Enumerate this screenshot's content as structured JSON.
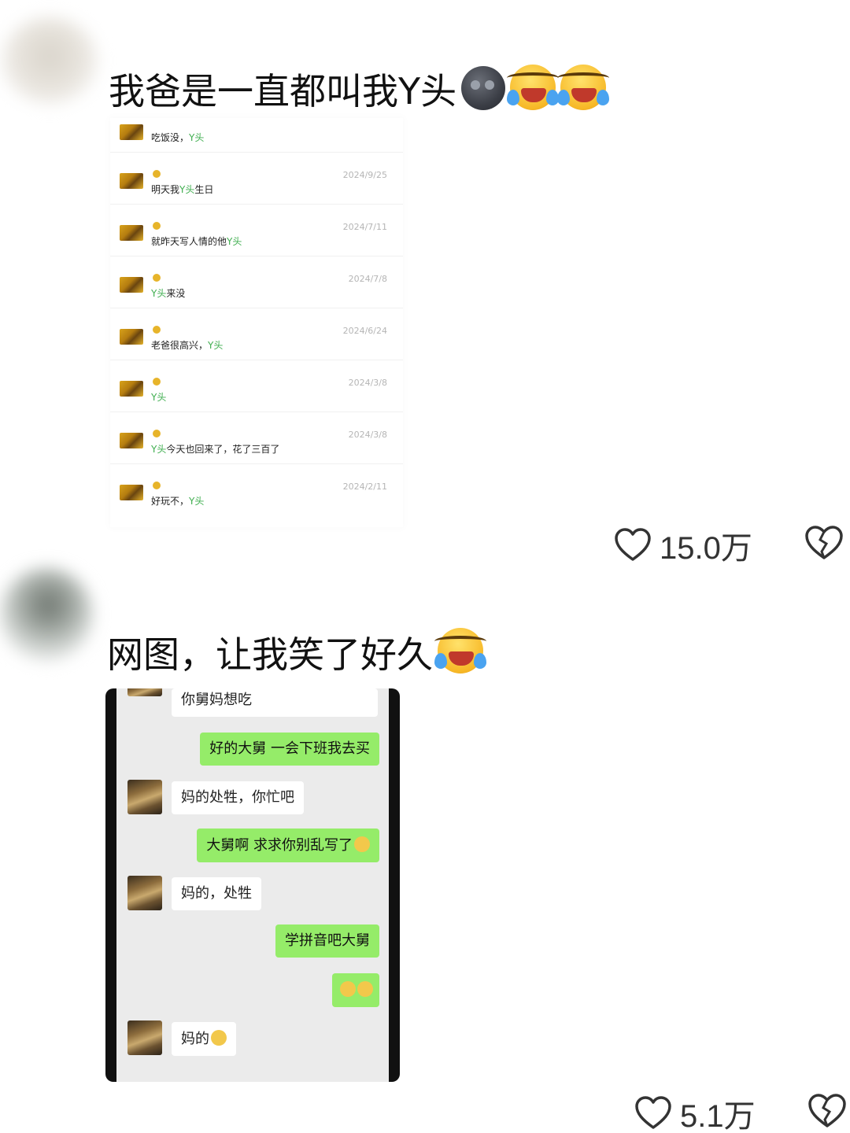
{
  "comments": [
    {
      "text": "我爸是一直都叫我Y头",
      "emojis": [
        "new-moon-face",
        "rolling-laughing",
        "rolling-laughing"
      ],
      "likes": "15.0万",
      "screenshot": {
        "items": [
          {
            "msg_prefix": "吃饭没，",
            "msg_highlight": "Y头",
            "msg_suffix": "",
            "date": ""
          },
          {
            "msg_prefix": "明天我",
            "msg_highlight": "Y头",
            "msg_suffix": "生日",
            "date": "2024/9/25"
          },
          {
            "msg_prefix": "就昨天写人情的他",
            "msg_highlight": "Y头",
            "msg_suffix": "",
            "date": "2024/7/11"
          },
          {
            "msg_prefix": "",
            "msg_highlight": "Y头",
            "msg_suffix": "来没",
            "date": "2024/7/8"
          },
          {
            "msg_prefix": "老爸很高兴，",
            "msg_highlight": "Y头",
            "msg_suffix": "",
            "date": "2024/6/24"
          },
          {
            "msg_prefix": "",
            "msg_highlight": "Y头",
            "msg_suffix": "",
            "date": "2024/3/8"
          },
          {
            "msg_prefix": "",
            "msg_highlight": "Y头",
            "msg_suffix": "今天也回来了，花了三百了",
            "date": "2024/3/8"
          },
          {
            "msg_prefix": "好玩不，",
            "msg_highlight": "Y头",
            "msg_suffix": "",
            "date": "2024/2/11"
          }
        ]
      }
    },
    {
      "text": "网图，让我笑了好久",
      "emojis": [
        "rolling-laughing"
      ],
      "likes": "5.1万",
      "screenshot": {
        "messages": [
          {
            "side": "in",
            "text": "你舅妈想吃"
          },
          {
            "side": "out",
            "text": "好的大舅 一会下班我去买"
          },
          {
            "side": "in",
            "text": "妈的处牲，你忙吧"
          },
          {
            "side": "out",
            "text": "大舅啊 求求你别乱写了"
          },
          {
            "side": "in",
            "text": "妈的，处牲"
          },
          {
            "side": "out",
            "text": "学拼音吧大舅"
          },
          {
            "side": "out",
            "text": ""
          },
          {
            "side": "in",
            "text": "妈的"
          }
        ]
      }
    }
  ],
  "colors": {
    "highlight_green": "#3fae4f",
    "bubble_green": "#95ec69"
  }
}
